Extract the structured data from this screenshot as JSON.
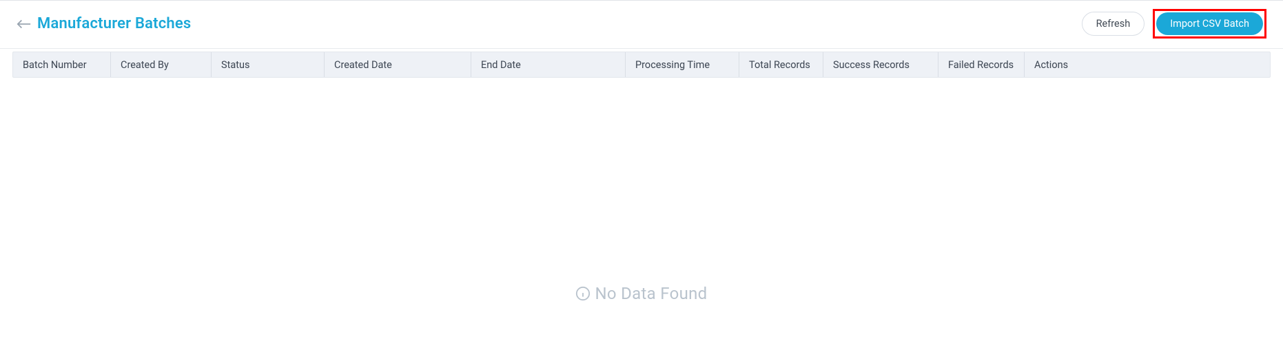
{
  "header": {
    "title": "Manufacturer Batches",
    "refresh_label": "Refresh",
    "import_label": "Import CSV Batch"
  },
  "table": {
    "columns": [
      "Batch Number",
      "Created By",
      "Status",
      "Created Date",
      "End Date",
      "Processing Time",
      "Total Records",
      "Success Records",
      "Failed Records",
      "Actions"
    ]
  },
  "empty_state": {
    "message": "No Data Found"
  }
}
